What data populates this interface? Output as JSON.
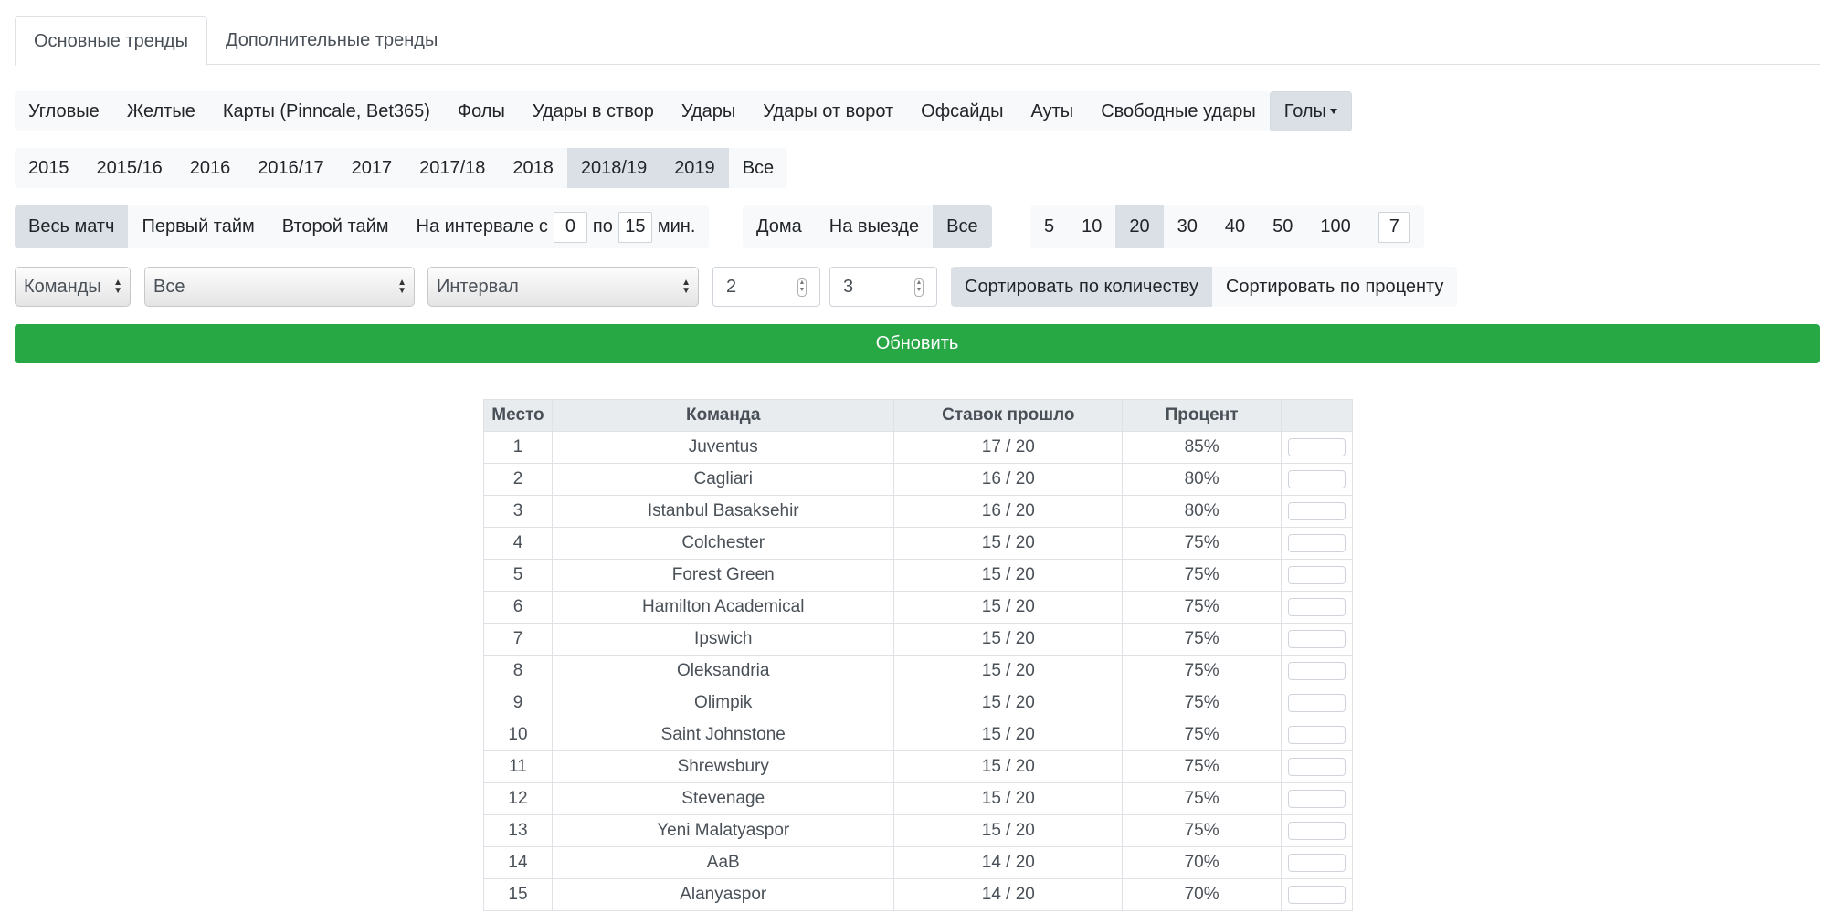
{
  "tabs": [
    "Основные тренды",
    "Дополнительные тренды"
  ],
  "categories": {
    "items": [
      "Угловые",
      "Желтые",
      "Карты (Pinncale, Bet365)",
      "Фолы",
      "Удары в створ",
      "Удары",
      "Удары от ворот",
      "Офсайды",
      "Ауты",
      "Свободные удары"
    ],
    "dropdown": "Голы"
  },
  "seasons": [
    "2015",
    "2015/16",
    "2016",
    "2016/17",
    "2017",
    "2017/18",
    "2018",
    "2018/19",
    "2019",
    "Все"
  ],
  "period": {
    "full_match": "Весь матч",
    "first_half": "Первый тайм",
    "second_half": "Второй тайм",
    "interval_prefix": "На интервале с",
    "interval_from": "0",
    "interval_mid": "по",
    "interval_to": "15",
    "interval_suffix": "мин."
  },
  "venue": [
    "Дома",
    "На выезде",
    "Все"
  ],
  "counts": [
    "5",
    "10",
    "20",
    "30",
    "40",
    "50",
    "100"
  ],
  "custom_count": "7",
  "filters": {
    "select_teams": "Команды",
    "select_all": "Все",
    "select_interval": "Интервал",
    "input_min": "2",
    "input_max": "3",
    "sort_count": "Сортировать по количеству",
    "sort_percent": "Сортировать по проценту"
  },
  "update_label": "Обновить",
  "table": {
    "headers": [
      "Место",
      "Команда",
      "Ставок прошло",
      "Процент",
      ""
    ],
    "rows": [
      [
        "1",
        "Juventus",
        "17 / 20",
        "85%"
      ],
      [
        "2",
        "Cagliari",
        "16 / 20",
        "80%"
      ],
      [
        "3",
        "Istanbul Basaksehir",
        "16 / 20",
        "80%"
      ],
      [
        "4",
        "Colchester",
        "15 / 20",
        "75%"
      ],
      [
        "5",
        "Forest Green",
        "15 / 20",
        "75%"
      ],
      [
        "6",
        "Hamilton Academical",
        "15 / 20",
        "75%"
      ],
      [
        "7",
        "Ipswich",
        "15 / 20",
        "75%"
      ],
      [
        "8",
        "Oleksandria",
        "15 / 20",
        "75%"
      ],
      [
        "9",
        "Olimpik",
        "15 / 20",
        "75%"
      ],
      [
        "10",
        "Saint Johnstone",
        "15 / 20",
        "75%"
      ],
      [
        "11",
        "Shrewsbury",
        "15 / 20",
        "75%"
      ],
      [
        "12",
        "Stevenage",
        "15 / 20",
        "75%"
      ],
      [
        "13",
        "Yeni Malatyaspor",
        "15 / 20",
        "75%"
      ],
      [
        "14",
        "AaB",
        "14 / 20",
        "70%"
      ],
      [
        "15",
        "Alanyaspor",
        "14 / 20",
        "70%"
      ]
    ]
  }
}
